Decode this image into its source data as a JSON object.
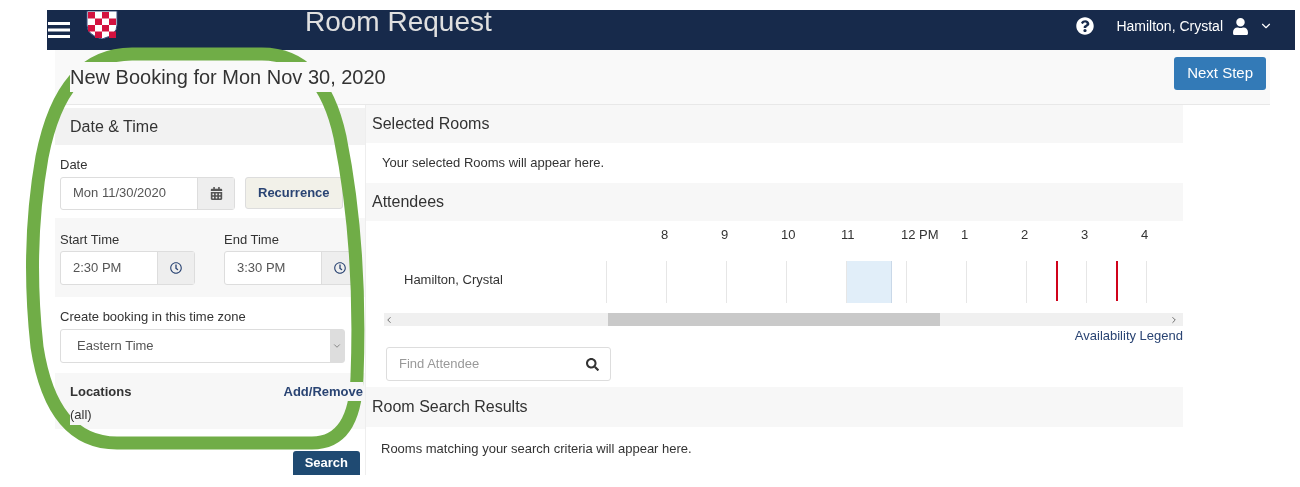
{
  "navbar": {
    "title": "Room Request",
    "user": "Hamilton, Crystal"
  },
  "booking": {
    "title": "New Booking for Mon Nov 30, 2020",
    "next_button": "Next Step"
  },
  "date_time": {
    "heading": "Date & Time",
    "date_label": "Date",
    "date_value": "Mon 11/30/2020",
    "recurrence_button": "Recurrence",
    "start_label": "Start Time",
    "start_value": "2:30 PM",
    "end_label": "End Time",
    "end_value": "3:30 PM",
    "timezone_label": "Create booking in this time zone",
    "timezone_value": "Eastern Time"
  },
  "locations": {
    "label": "Locations",
    "action": "Add/Remove",
    "value": "(all)"
  },
  "search_button": "Search",
  "selected_rooms": {
    "heading": "Selected Rooms",
    "empty_text": "Your selected Rooms will appear here."
  },
  "attendees": {
    "heading": "Attendees",
    "hours": [
      "8",
      "9",
      "10",
      "11",
      "12 PM",
      "1",
      "2",
      "3",
      "4"
    ],
    "rows": [
      {
        "name": "Hamilton, Crystal",
        "slots": [
          {
            "busy": false
          },
          {
            "busy": false
          },
          {
            "busy": false
          },
          {
            "busy": false
          },
          {
            "busy": true
          },
          {
            "busy": false
          },
          {
            "busy": false
          },
          {
            "busy": false
          },
          {
            "busy": false
          },
          {
            "busy": false
          }
        ]
      }
    ],
    "find_placeholder": "Find Attendee",
    "legend_link": "Availability Legend"
  },
  "results": {
    "heading": "Room Search Results",
    "empty_text": "Rooms matching your search criteria will appear here."
  }
}
